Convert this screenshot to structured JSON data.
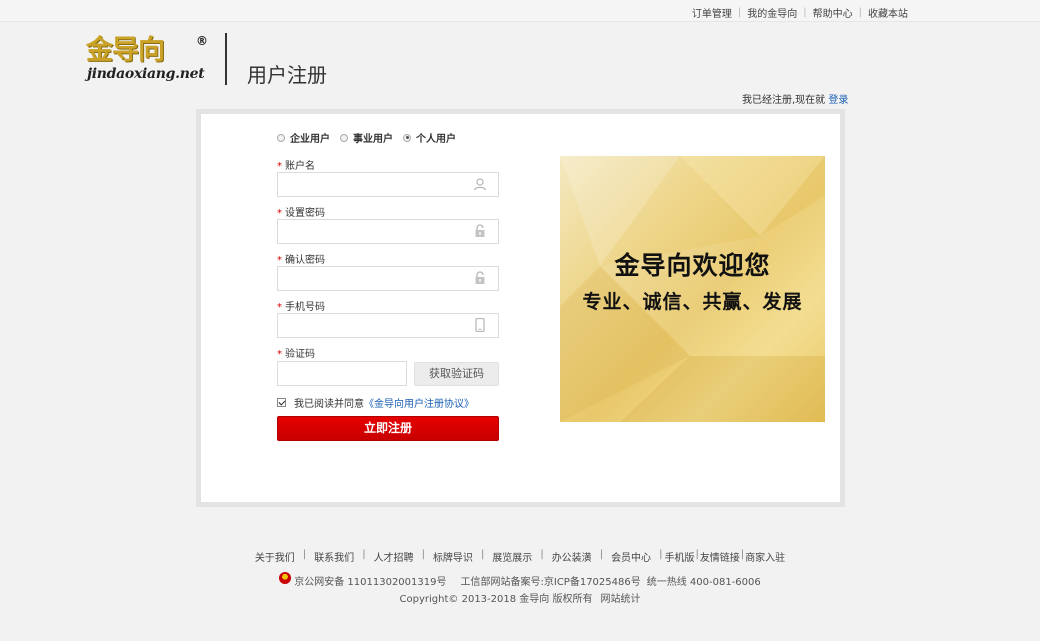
{
  "topnav": {
    "items": [
      "订单管理",
      "我的金导向",
      "帮助中心",
      "收藏本站"
    ]
  },
  "header": {
    "logo_cn": "金导向",
    "logo_reg": "®",
    "logo_en": "jindaoxiang.net",
    "title": "用户注册",
    "login_hint": "我已经注册,现在就",
    "login_link": "登录"
  },
  "form": {
    "user_types": [
      {
        "label": "企业用户",
        "selected": false
      },
      {
        "label": "事业用户",
        "selected": false
      },
      {
        "label": "个人用户",
        "selected": true
      }
    ],
    "required_mark": "*",
    "fields": {
      "username": {
        "label": "账户名",
        "value": "",
        "icon": "user-icon"
      },
      "password": {
        "label": "设置密码",
        "value": "",
        "icon": "lock-icon"
      },
      "confirm": {
        "label": "确认密码",
        "value": "",
        "icon": "lock-icon"
      },
      "phone": {
        "label": "手机号码",
        "value": "",
        "icon": "mobile-icon"
      },
      "code": {
        "label": "验证码",
        "value": ""
      }
    },
    "get_code_label": "获取验证码",
    "agree_checked": true,
    "agree_text": "我已阅读并同意",
    "agree_link": "《金导向用户注册协议》",
    "submit_label": "立即注册"
  },
  "banner": {
    "title": "金导向欢迎您",
    "subtitle": "专业、诚信、共赢、发展"
  },
  "footer": {
    "links": [
      "关于我们",
      "联系我们",
      "人才招聘",
      "标牌导识",
      "展览展示",
      "办公装潢",
      "会员中心"
    ],
    "links_tail": [
      "手机版",
      "友情链接",
      "商家入驻"
    ],
    "police_record": "京公网安备 11011302001319号",
    "icp_record": "工信部网站备案号:京ICP备17025486号",
    "hotline": "统一热线 400-081-6006",
    "copyright": "Copyright© 2013-2018 金导向 版权所有",
    "stats_link": "网站统计"
  },
  "colors": {
    "accent_red": "#d40000",
    "link_blue": "#1a5fb4",
    "banner_gold": "#e8c86a"
  }
}
